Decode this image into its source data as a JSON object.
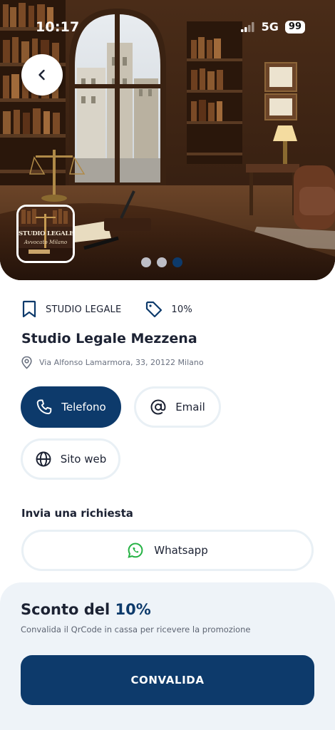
{
  "status_bar": {
    "time": "10:17",
    "network": "5G",
    "battery": "99"
  },
  "hero": {
    "logo": {
      "name": "STUDIO LEGALE MEZZENA",
      "subtitle": "Avvocato Milano"
    },
    "carousel": {
      "count": 3,
      "active_index": 2
    }
  },
  "business": {
    "category": "STUDIO LEGALE",
    "discount_tag": "10%",
    "name": "Studio Legale Mezzena",
    "address": "Via Alfonso Lamarmora, 33, 20122 Milano"
  },
  "actions": {
    "phone_label": "Telefono",
    "email_label": "Email",
    "website_label": "Sito web"
  },
  "request": {
    "title": "Invia una richiesta",
    "whatsapp_label": "Whatsapp"
  },
  "promo": {
    "title_prefix": "Sconto del ",
    "title_value": "10%",
    "subtitle": "Convalida il QrCode in cassa per ricevere la promozione",
    "cta_label": "CONVALIDA"
  },
  "colors": {
    "primary": "#0d3a6b",
    "sheet_bg": "#eef3f8",
    "pill_border": "#e9f0f5",
    "whatsapp": "#25b244"
  },
  "icons": {
    "back": "chevron-left-icon",
    "category": "bookmark-icon",
    "discount": "tag-icon",
    "address": "location-pin-icon",
    "phone": "phone-icon",
    "email": "at-sign-icon",
    "website": "globe-icon",
    "whatsapp": "whatsapp-icon"
  }
}
